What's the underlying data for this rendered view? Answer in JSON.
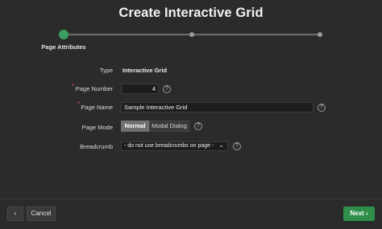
{
  "dialog": {
    "title": "Create Interactive Grid"
  },
  "wizard": {
    "steps": [
      {
        "label": "Page Attributes",
        "state": "current"
      },
      {
        "state": "pending"
      },
      {
        "state": "pending"
      }
    ]
  },
  "form": {
    "type": {
      "label": "Type",
      "value": "Interactive Grid"
    },
    "page_number": {
      "label": "Page Number",
      "required": "*",
      "value": "4",
      "help": "?"
    },
    "page_name": {
      "label": "Page Name",
      "required": "*",
      "value": "Sample Interactive Grid",
      "help": "?"
    },
    "page_mode": {
      "label": "Page Mode",
      "options": [
        "Normal",
        "Modal Dialog"
      ],
      "selected": "Normal",
      "help": "?"
    },
    "breadcrumb": {
      "label": "Breadcrumb",
      "value": "- do not use breadcrumbs on page -",
      "help": "?"
    }
  },
  "footer": {
    "back_icon": "‹",
    "cancel_label": "Cancel",
    "next_label": "Next",
    "next_icon": "›"
  },
  "colors": {
    "accent": "#2f8f4a",
    "step_active": "#3a9f5f",
    "required": "#e0464f",
    "background": "#2b2b2b"
  }
}
